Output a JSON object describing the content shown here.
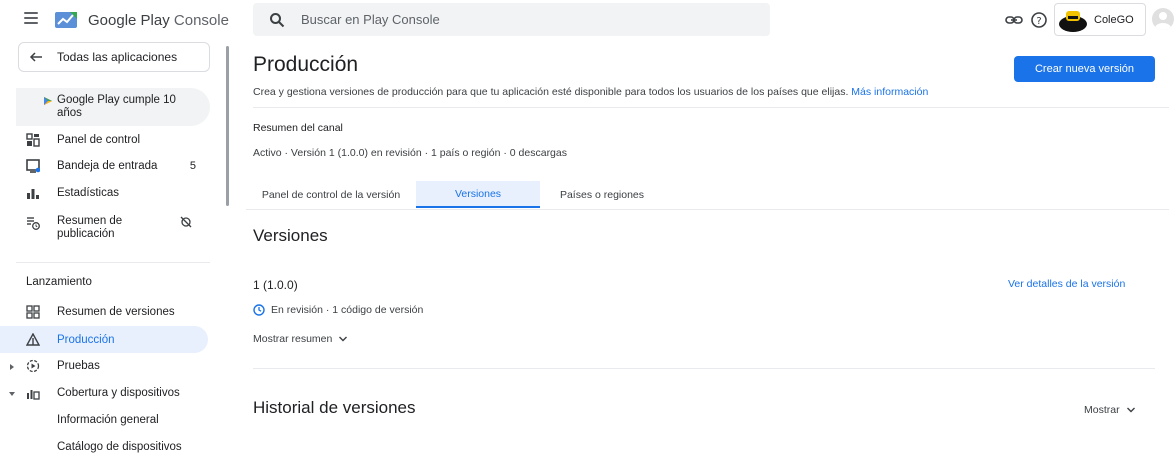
{
  "app": {
    "title_prefix": "Google Play",
    "title_suffix": "Console"
  },
  "search": {
    "placeholder": "Buscar en Play Console"
  },
  "account": {
    "name": "ColeGO"
  },
  "sidebar": {
    "back_label": "Todas las aplicaciones",
    "promo_label": "Google Play cumple 10 años",
    "items": [
      {
        "label": "Panel de control"
      },
      {
        "label": "Bandeja de entrada",
        "count": "5"
      },
      {
        "label": "Estadísticas"
      },
      {
        "label": "Resumen de publicación"
      }
    ],
    "section_title": "Lanzamiento",
    "launch_items": [
      {
        "label": "Resumen de versiones"
      },
      {
        "label": "Producción"
      },
      {
        "label": "Pruebas"
      },
      {
        "label": "Cobertura y dispositivos"
      }
    ],
    "sub_items": [
      {
        "label": "Información general"
      },
      {
        "label": "Catálogo de dispositivos"
      }
    ]
  },
  "main": {
    "title": "Producción",
    "description": "Crea y gestiona versiones de producción para que tu aplicación esté disponible para todos los usuarios de los países que elijas.",
    "more_info": "Más información",
    "create_button": "Crear nueva versión",
    "channel_title": "Resumen del canal",
    "channel_status": "Activo · Versión 1 (1.0.0) en revisión · 1 país o región · 0 descargas",
    "tabs": [
      {
        "label": "Panel de control de la versión"
      },
      {
        "label": "Versiones"
      },
      {
        "label": "Países o regiones"
      }
    ],
    "active_tab": "Versiones",
    "versions_heading": "Versiones",
    "release": {
      "name": "1 (1.0.0)",
      "details_link": "Ver detalles de la versión",
      "status": "En revisión · 1 código de versión",
      "show_summary": "Mostrar resumen"
    },
    "history_heading": "Historial de versiones",
    "history_show": "Mostrar"
  },
  "colors": {
    "accent": "#1a73e8",
    "active_bg": "#e8f0fe",
    "text": "#202124",
    "muted": "#5f6368"
  }
}
